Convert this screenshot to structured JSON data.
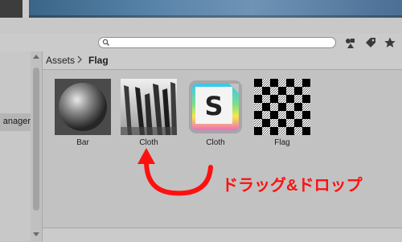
{
  "colors": {
    "accent_red": "#ff1010",
    "panel_bg": "#c2c2c2"
  },
  "left_panel": {
    "partial_label": "anager"
  },
  "breadcrumb": {
    "root": "Assets",
    "current": "Flag"
  },
  "assets": [
    {
      "name": "Bar",
      "icon": "sphere-material-icon"
    },
    {
      "name": "Cloth",
      "icon": "cloth-texture-icon"
    },
    {
      "name": "Cloth",
      "icon": "substance-s-icon"
    },
    {
      "name": "Flag",
      "icon": "checker-texture-icon"
    }
  ],
  "annotation": {
    "text": "ドラッグ&ドロップ"
  }
}
